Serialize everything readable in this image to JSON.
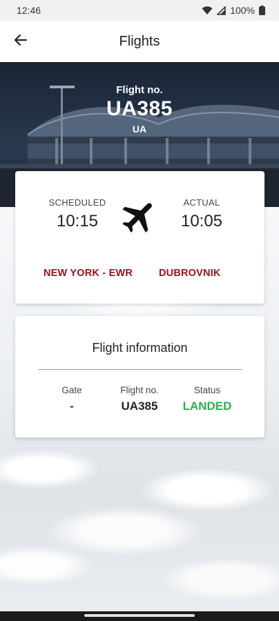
{
  "status_bar": {
    "time": "12:46",
    "battery": "100%",
    "icons": [
      "wifi-icon",
      "signal-icon",
      "battery-icon"
    ]
  },
  "app_bar": {
    "title": "Flights",
    "back_icon": "arrow-left-icon"
  },
  "hero": {
    "label": "Flight no.",
    "flight_number": "UA385",
    "airline_code": "UA"
  },
  "schedule": {
    "scheduled_label": "SCHEDULED",
    "scheduled_time": "10:15",
    "actual_label": "ACTUAL",
    "actual_time": "10:05",
    "from": "NEW YORK - EWR",
    "to": "DUBROVNIK",
    "plane_icon": "airplane-icon"
  },
  "info": {
    "title": "Flight information",
    "gate_label": "Gate",
    "gate_value": "-",
    "flight_label": "Flight no.",
    "flight_value": "UA385",
    "status_label": "Status",
    "status_value": "LANDED"
  },
  "colors": {
    "route": "#9b1217",
    "status_landed": "#2bb24c",
    "hero_bg": "#1f2a3a"
  }
}
